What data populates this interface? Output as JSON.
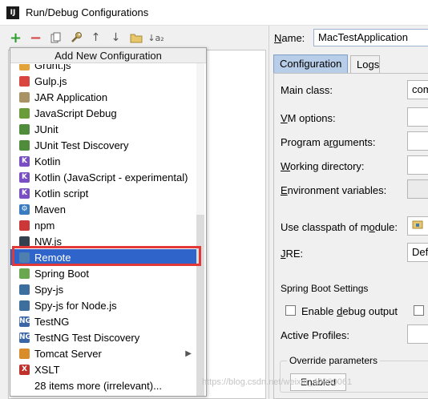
{
  "window": {
    "title": "Run/Debug Configurations",
    "app_icon_text": "IJ"
  },
  "toolbar": {
    "icons": [
      "add-icon",
      "remove-icon",
      "copy-icon",
      "wrench-icon",
      "move-up-icon",
      "move-down-icon",
      "folder-icon",
      "sort-icon"
    ],
    "add_glyph": "+",
    "remove_glyph": "−",
    "up_glyph": "↑",
    "down_glyph": "↓",
    "sort_glyph": "↓a₂"
  },
  "popup": {
    "title": "Add New Configuration",
    "items": [
      {
        "label": "Grunt.js",
        "icon": "grunt-icon",
        "color": "#e3a33b",
        "glyph": ""
      },
      {
        "label": "Gulp.js",
        "icon": "gulp-icon",
        "color": "#d9463f",
        "glyph": ""
      },
      {
        "label": "JAR Application",
        "icon": "jar-icon",
        "color": "#a89266",
        "glyph": ""
      },
      {
        "label": "JavaScript Debug",
        "icon": "js-debug-icon",
        "color": "#6a9c3b",
        "glyph": ""
      },
      {
        "label": "JUnit",
        "icon": "junit-icon",
        "color": "#4f8c3b",
        "glyph": ""
      },
      {
        "label": "JUnit Test Discovery",
        "icon": "junit-discovery-icon",
        "color": "#4f8c3b",
        "glyph": ""
      },
      {
        "label": "Kotlin",
        "icon": "kotlin-icon",
        "color": "#7a4ec4",
        "glyph": "K"
      },
      {
        "label": "Kotlin (JavaScript - experimental)",
        "icon": "kotlin-js-icon",
        "color": "#7a4ec4",
        "glyph": "K"
      },
      {
        "label": "Kotlin script",
        "icon": "kotlin-script-icon",
        "color": "#7a4ec4",
        "glyph": "K"
      },
      {
        "label": "Maven",
        "icon": "maven-icon",
        "color": "#3a7cc2",
        "glyph": "⚙"
      },
      {
        "label": "npm",
        "icon": "npm-icon",
        "color": "#cb3837",
        "glyph": ""
      },
      {
        "label": "NW.js",
        "icon": "nwjs-icon",
        "color": "#33414f",
        "glyph": ""
      },
      {
        "label": "Remote",
        "icon": "remote-icon",
        "color": "#4f7fae",
        "glyph": ""
      },
      {
        "label": "Spring Boot",
        "icon": "spring-boot-icon",
        "color": "#6aa84f",
        "glyph": ""
      },
      {
        "label": "Spy-js",
        "icon": "spyjs-icon",
        "color": "#3d6f9e",
        "glyph": ""
      },
      {
        "label": "Spy-js for Node.js",
        "icon": "spyjs-node-icon",
        "color": "#3d6f9e",
        "glyph": ""
      },
      {
        "label": "TestNG",
        "icon": "testng-icon",
        "color": "#3a66a8",
        "glyph": "NG"
      },
      {
        "label": "TestNG Test Discovery",
        "icon": "testng-discovery-icon",
        "color": "#3a66a8",
        "glyph": "NG"
      },
      {
        "label": "Tomcat Server",
        "icon": "tomcat-icon",
        "color": "#d88c2a",
        "glyph": "",
        "submenu": true,
        "submenu_glyph": "▶"
      },
      {
        "label": "XSLT",
        "icon": "xslt-icon",
        "color": "#c0312b",
        "glyph": "X"
      },
      {
        "label": "28 items more (irrelevant)...",
        "icon": "",
        "color": "",
        "glyph": ""
      }
    ],
    "selected_index": 12
  },
  "config": {
    "name_label": "Name:",
    "name_value": "MacTestApplication",
    "tabs": [
      "Configuration",
      "Logs"
    ],
    "active_tab": 0,
    "fields": [
      {
        "label": "Main class:",
        "value": "com"
      },
      {
        "label": "VM options:",
        "value": ""
      },
      {
        "label": "Program arguments:",
        "value": ""
      },
      {
        "label": "Working directory:",
        "value": ""
      },
      {
        "label": "Environment variables:",
        "value": ""
      },
      {
        "label": "Use classpath of module:",
        "value": ""
      },
      {
        "label": "JRE:",
        "value": "Def"
      }
    ],
    "spring_boot_settings": "Spring Boot Settings",
    "enable_debug_output": "Enable debug output",
    "active_profiles": "Active Profiles:",
    "override_parameters": "Override parameters",
    "enabled_tab": "Enabled"
  },
  "watermark": "https://blog.csdn.net/weixin_40960061"
}
